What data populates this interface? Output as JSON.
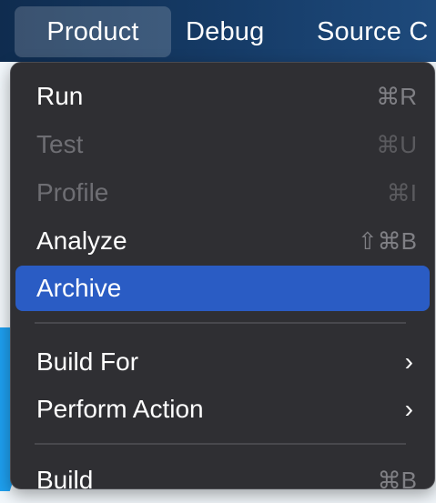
{
  "menubar": {
    "product": "Product",
    "debug": "Debug",
    "source_control": "Source C"
  },
  "menu": {
    "items": [
      {
        "label": "Run",
        "shortcut": "⌘R",
        "enabled": true
      },
      {
        "label": "Test",
        "shortcut": "⌘U",
        "enabled": false
      },
      {
        "label": "Profile",
        "shortcut": "⌘I",
        "enabled": false
      },
      {
        "label": "Analyze",
        "shortcut": "⇧⌘B",
        "enabled": true
      },
      {
        "label": "Archive",
        "shortcut": "",
        "enabled": true,
        "highlighted": true
      },
      {
        "label": "Build For",
        "submenu_indicator": "›",
        "enabled": true
      },
      {
        "label": "Perform Action",
        "submenu_indicator": "›",
        "enabled": true
      },
      {
        "label": "Build",
        "shortcut": "⌘B",
        "enabled": true
      }
    ]
  },
  "colors": {
    "menubar_bg": "#163c68",
    "menu_bg": "#2f2f33",
    "highlight": "#2a5cc4",
    "disabled_text": "#6e6e73",
    "shortcut_text": "#808085"
  }
}
